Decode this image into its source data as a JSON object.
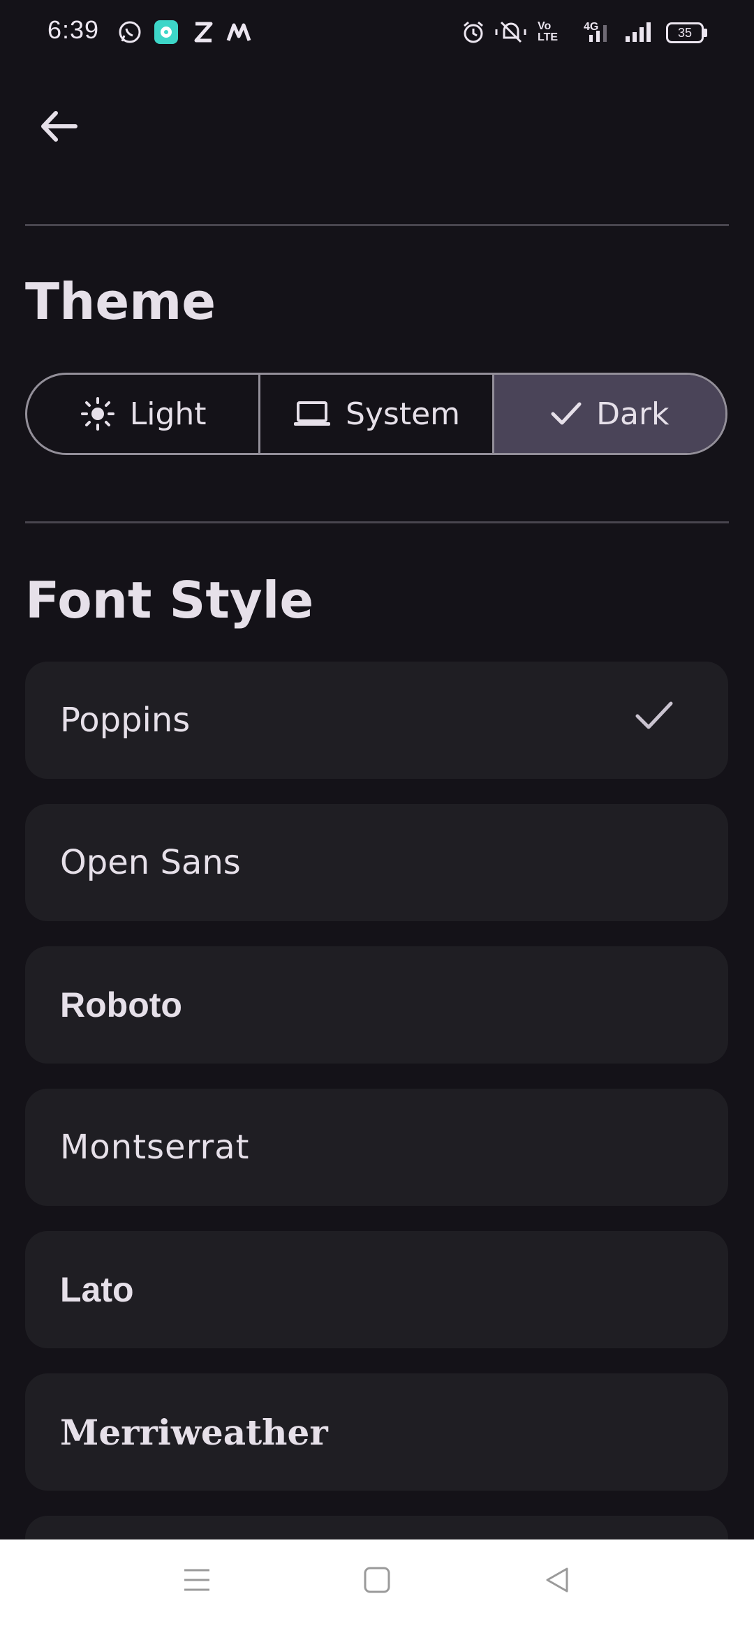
{
  "status_bar": {
    "time": "6:39",
    "battery": "35",
    "network": "4G",
    "volte": "Vo LTE",
    "notification_icons": [
      "whatsapp-icon",
      "app-icon",
      "z-icon",
      "m-icon"
    ],
    "system_icons": [
      "alarm-icon",
      "mute-icon",
      "volte-icon",
      "signal-icon",
      "battery-icon"
    ]
  },
  "header": {
    "back_icon": "arrow-back-icon"
  },
  "theme": {
    "title": "Theme",
    "options": [
      {
        "label": "Light",
        "icon": "sun-icon",
        "selected": false
      },
      {
        "label": "System",
        "icon": "laptop-icon",
        "selected": false
      },
      {
        "label": "Dark",
        "icon": "check-icon",
        "selected": true
      }
    ]
  },
  "font_style": {
    "title": "Font Style",
    "items": [
      {
        "label": "Poppins",
        "selected": true
      },
      {
        "label": "Open Sans",
        "selected": false
      },
      {
        "label": "Roboto",
        "selected": false
      },
      {
        "label": "Montserrat",
        "selected": false
      },
      {
        "label": "Lato",
        "selected": false
      },
      {
        "label": "Merriweather",
        "selected": false
      }
    ]
  },
  "nav_bar": {
    "buttons": [
      "menu-icon",
      "home-icon",
      "back-triangle-icon"
    ]
  },
  "colors": {
    "background": "#141218",
    "surface": "#1F1E23",
    "selected_segment": "#4A4458",
    "outline": "#938F99",
    "divider": "#48454E",
    "text": "#E6E0E9",
    "nav_background": "#FFFFFF"
  }
}
